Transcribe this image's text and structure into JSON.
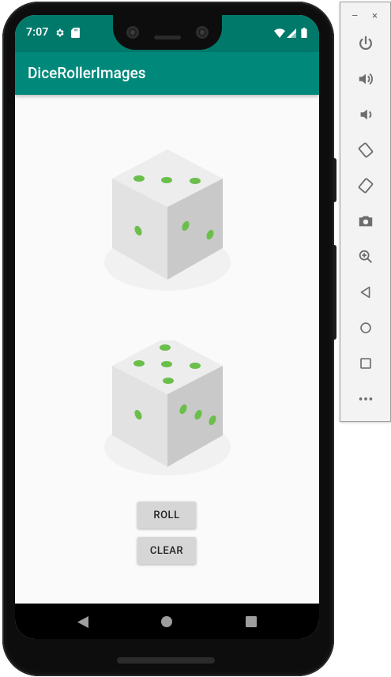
{
  "status_bar": {
    "time": "7:07",
    "icons": [
      "gear-icon",
      "sd-card-icon",
      "wifi-icon",
      "signal-icon",
      "battery-icon"
    ],
    "color": "#00796b"
  },
  "app_bar": {
    "title": "DiceRollerImages",
    "color": "#00897b"
  },
  "dice": [
    {
      "name": "dice-top",
      "top_face_pips": 3,
      "left_face_pips": 1,
      "right_face_pips": 2
    },
    {
      "name": "dice-bottom",
      "top_face_pips": 5,
      "left_face_pips": 1,
      "right_face_pips": 3
    }
  ],
  "buttons": {
    "roll_label": "ROLL",
    "clear_label": "CLEAR"
  },
  "nav_bar": {
    "items": [
      "back-icon",
      "home-icon",
      "recents-icon"
    ]
  },
  "emulator_toolbar": {
    "minimize_label": "–",
    "close_label": "×",
    "items": [
      "power-icon",
      "volume-up-icon",
      "volume-down-icon",
      "rotate-left-icon",
      "rotate-right-icon",
      "camera-icon",
      "zoom-icon",
      "back-icon",
      "home-icon",
      "overview-icon",
      "more-icon"
    ]
  },
  "colors": {
    "pip_green": "#6abf4b",
    "die_top": "#ededed",
    "die_left": "#e2e2e2",
    "die_right": "#c9c9c9"
  }
}
